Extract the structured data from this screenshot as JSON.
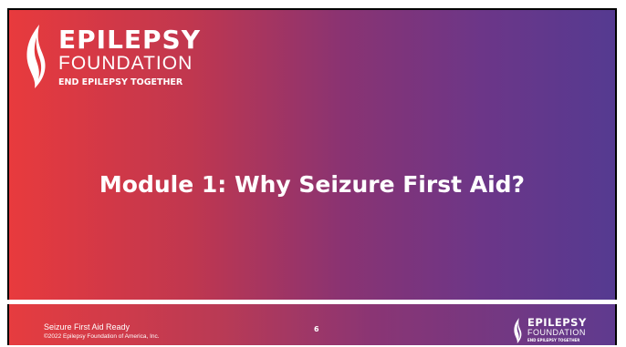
{
  "slide": {
    "title": "Module 1: Why Seizure First Aid?",
    "logo": {
      "line1": "EPILEPSY",
      "line2": "FOUNDATION",
      "tagline": "END EPILEPSY TOGETHER"
    }
  },
  "footer": {
    "course_title": "Seizure First Aid Ready",
    "copyright": "©2022 Epilepsy Foundation of America, Inc.",
    "page_number": "6",
    "logo": {
      "line1": "EPILEPSY",
      "line2": "FOUNDATION",
      "tagline": "END EPILEPSY TOGETHER"
    }
  },
  "colors": {
    "gradient_start": "#e83a3d",
    "gradient_end": "#553a91",
    "text": "#ffffff",
    "border": "#000000"
  },
  "icons": {
    "logo": "flame-icon",
    "footer_logo": "flame-icon"
  }
}
